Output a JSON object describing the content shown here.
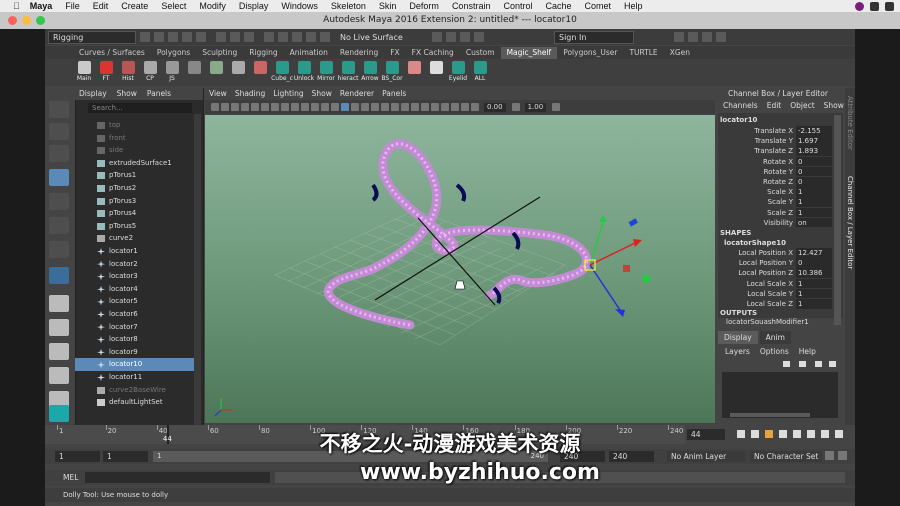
{
  "menubar": {
    "app": "Maya",
    "items": [
      "File",
      "Edit",
      "Create",
      "Select",
      "Modify",
      "Display",
      "Windows",
      "Skeleton",
      "Skin",
      "Deform",
      "Constrain",
      "Control",
      "Cache",
      "Comet",
      "Help"
    ]
  },
  "titlebar": {
    "title": "Autodesk Maya 2016 Extension 2: untitled*   ---   locator10"
  },
  "status": {
    "menuset": "Rigging",
    "live_surface": "No Live Surface",
    "sign_in": "Sign In"
  },
  "shelf_tabs": [
    "Curves / Surfaces",
    "Polygons",
    "Sculpting",
    "Rigging",
    "Animation",
    "Rendering",
    "FX",
    "FX Caching",
    "Custom",
    "Magic_Shelf",
    "Polygons_User",
    "TURTLE",
    "XGen"
  ],
  "active_shelf_tab": "Magic_Shelf",
  "shelf_tools": [
    "Main",
    "FT",
    "Hist",
    "CP",
    "JS",
    "",
    "",
    "",
    "",
    "Cube_c",
    "Unlock",
    "Mirror",
    "hieract",
    "Arrow",
    "BS_Cor",
    "",
    "",
    "Eyelid",
    "ALL"
  ],
  "outliner": {
    "menu": [
      "Display",
      "Show",
      "Panels"
    ],
    "search_placeholder": "Search...",
    "items": [
      {
        "label": "top",
        "dim": true,
        "icon": "camera-icon"
      },
      {
        "label": "front",
        "dim": true,
        "icon": "camera-icon"
      },
      {
        "label": "side",
        "dim": true,
        "icon": "camera-icon"
      },
      {
        "label": "extrudedSurface1",
        "icon": "nurbs-surface-icon"
      },
      {
        "label": "pTorus1",
        "icon": "polygon-mesh-icon"
      },
      {
        "label": "pTorus2",
        "icon": "polygon-mesh-icon"
      },
      {
        "label": "pTorus3",
        "icon": "polygon-mesh-icon"
      },
      {
        "label": "pTorus4",
        "icon": "polygon-mesh-icon"
      },
      {
        "label": "pTorus5",
        "icon": "polygon-mesh-icon"
      },
      {
        "label": "curve2",
        "icon": "curve-icon"
      },
      {
        "label": "locator1",
        "icon": "locator-icon"
      },
      {
        "label": "locator2",
        "icon": "locator-icon"
      },
      {
        "label": "locator3",
        "icon": "locator-icon"
      },
      {
        "label": "locator4",
        "icon": "locator-icon"
      },
      {
        "label": "locator5",
        "icon": "locator-icon"
      },
      {
        "label": "locator6",
        "icon": "locator-icon"
      },
      {
        "label": "locator7",
        "icon": "locator-icon"
      },
      {
        "label": "locator8",
        "icon": "locator-icon"
      },
      {
        "label": "locator9",
        "icon": "locator-icon"
      },
      {
        "label": "locator10",
        "icon": "locator-icon",
        "selected": true
      },
      {
        "label": "locator11",
        "icon": "locator-icon"
      },
      {
        "label": "curve2BaseWire",
        "dim": true,
        "icon": "curve-icon"
      },
      {
        "label": "defaultLightSet",
        "icon": "set-icon"
      }
    ]
  },
  "viewport": {
    "menu": [
      "View",
      "Shading",
      "Lighting",
      "Show",
      "Renderer",
      "Panels"
    ],
    "field1": "0.00",
    "field2": "1.00"
  },
  "channel_box": {
    "header": "Channel Box / Layer Editor",
    "menu": [
      "Channels",
      "Edit",
      "Object",
      "Show"
    ],
    "object": "locator10",
    "channels": [
      {
        "label": "Translate X",
        "value": "-2.155"
      },
      {
        "label": "Translate Y",
        "value": "1.697"
      },
      {
        "label": "Translate Z",
        "value": "1.893"
      },
      {
        "label": "Rotate X",
        "value": "0"
      },
      {
        "label": "Rotate Y",
        "value": "0"
      },
      {
        "label": "Rotate Z",
        "value": "0"
      },
      {
        "label": "Scale X",
        "value": "1"
      },
      {
        "label": "Scale Y",
        "value": "1"
      },
      {
        "label": "Scale Z",
        "value": "1"
      },
      {
        "label": "Visibility",
        "value": "on"
      }
    ],
    "shapes_title": "SHAPES",
    "shape_name": "locatorShape10",
    "shape_channels": [
      {
        "label": "Local Position X",
        "value": "12.427"
      },
      {
        "label": "Local Position Y",
        "value": "0"
      },
      {
        "label": "Local Position Z",
        "value": "10.386"
      },
      {
        "label": "Local Scale X",
        "value": "1"
      },
      {
        "label": "Local Scale Y",
        "value": "1"
      },
      {
        "label": "Local Scale Z",
        "value": "1"
      }
    ],
    "outputs_title": "OUTPUTS",
    "output_name": "locatorSquashModifier1",
    "side_tabs": [
      "Attribute Editor",
      "Channel Box / Layer Editor"
    ]
  },
  "layer_editor": {
    "tabs": [
      "Display",
      "Anim"
    ],
    "menu": [
      "Layers",
      "Options",
      "Help"
    ]
  },
  "timeline": {
    "ticks": [
      "1",
      "20",
      "40",
      "60",
      "80",
      "100",
      "120",
      "140",
      "160",
      "180",
      "200",
      "220",
      "240"
    ],
    "current_frame_marker": "44",
    "current_frame": "44"
  },
  "range": {
    "start": "1",
    "start_inner": "1",
    "range_start_label": "1",
    "range_end_label": "240",
    "end_inner": "240",
    "end": "240",
    "anim_layer": "No Anim Layer",
    "character_set": "No Character Set"
  },
  "command_line": {
    "label": "MEL"
  },
  "help_line": {
    "text": "Dolly Tool: Use mouse to dolly"
  },
  "watermark": {
    "line1": "不移之火-动漫游戏美术资源",
    "line2": "www.byzhihuo.com"
  }
}
